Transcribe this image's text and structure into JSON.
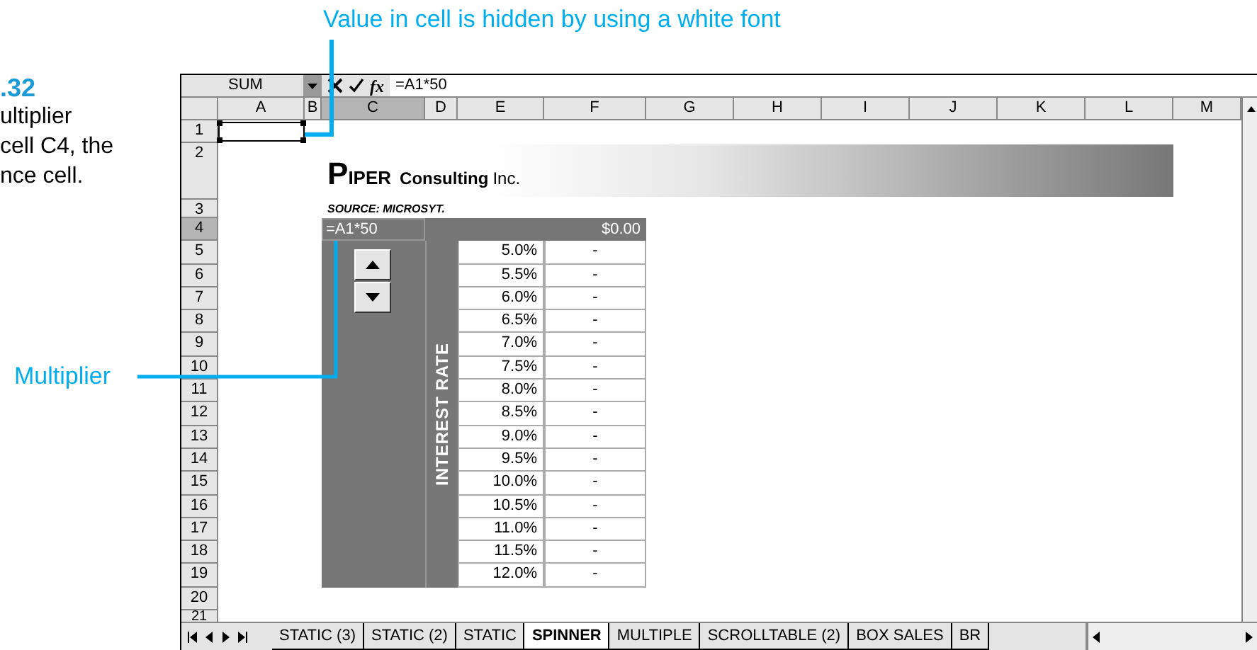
{
  "figure_label": ".32",
  "caption_lines": [
    "ultiplier",
    "cell C4, the",
    "nce cell."
  ],
  "callouts": [
    {
      "text": "Value in cell is hidden by using a white font"
    },
    {
      "text": "Multiplier"
    }
  ],
  "formula_bar": {
    "name_box": "SUM",
    "function_label": "fx",
    "formula": "=A1*50"
  },
  "columns": [
    {
      "label": "A",
      "selected": false
    },
    {
      "label": "B",
      "selected": false
    },
    {
      "label": "C",
      "selected": true
    },
    {
      "label": "D",
      "selected": false
    },
    {
      "label": "E",
      "selected": false
    },
    {
      "label": "F",
      "selected": false
    },
    {
      "label": "G",
      "selected": false
    },
    {
      "label": "H",
      "selected": false
    },
    {
      "label": "I",
      "selected": false
    },
    {
      "label": "J",
      "selected": false
    },
    {
      "label": "K",
      "selected": false
    },
    {
      "label": "L",
      "selected": false
    },
    {
      "label": "M",
      "selected": false
    }
  ],
  "rows": [
    {
      "label": "1",
      "selected": false
    },
    {
      "label": "2",
      "selected": false
    },
    {
      "label": "3",
      "selected": false
    },
    {
      "label": "4",
      "selected": true
    },
    {
      "label": "5",
      "selected": false
    },
    {
      "label": "6",
      "selected": false
    },
    {
      "label": "7",
      "selected": false
    },
    {
      "label": "8",
      "selected": false
    },
    {
      "label": "9",
      "selected": false
    },
    {
      "label": "10",
      "selected": false
    },
    {
      "label": "11",
      "selected": false
    },
    {
      "label": "12",
      "selected": false
    },
    {
      "label": "13",
      "selected": false
    },
    {
      "label": "14",
      "selected": false
    },
    {
      "label": "15",
      "selected": false
    },
    {
      "label": "16",
      "selected": false
    },
    {
      "label": "17",
      "selected": false
    },
    {
      "label": "18",
      "selected": false
    },
    {
      "label": "19",
      "selected": false
    },
    {
      "label": "20",
      "selected": false
    },
    {
      "label": "21",
      "selected": false
    }
  ],
  "linked_cell": {
    "selected": true
  },
  "logo": {
    "initial": "P",
    "name": "IPER",
    "subtitle": "Consulting",
    "suffix": "Inc."
  },
  "source": "SOURCE: MICROSYT.",
  "input_cell": "=A1*50",
  "result": "$0.00",
  "axis_label": "INTEREST RATE",
  "table": [
    {
      "rate": "5.0%",
      "value": "-"
    },
    {
      "rate": "5.5%",
      "value": "-"
    },
    {
      "rate": "6.0%",
      "value": "-"
    },
    {
      "rate": "6.5%",
      "value": "-"
    },
    {
      "rate": "7.0%",
      "value": "-"
    },
    {
      "rate": "7.5%",
      "value": "-"
    },
    {
      "rate": "8.0%",
      "value": "-"
    },
    {
      "rate": "8.5%",
      "value": "-"
    },
    {
      "rate": "9.0%",
      "value": "-"
    },
    {
      "rate": "9.5%",
      "value": "-"
    },
    {
      "rate": "10.0%",
      "value": "-"
    },
    {
      "rate": "10.5%",
      "value": "-"
    },
    {
      "rate": "11.0%",
      "value": "-"
    },
    {
      "rate": "11.5%",
      "value": "-"
    },
    {
      "rate": "12.0%",
      "value": "-"
    }
  ],
  "sheet_tabs": [
    {
      "label": "STATIC (3)",
      "selected": false
    },
    {
      "label": "STATIC (2)",
      "selected": false
    },
    {
      "label": "STATIC",
      "selected": false
    },
    {
      "label": "SPINNER",
      "selected": true
    },
    {
      "label": "MULTIPLE",
      "selected": false
    },
    {
      "label": "SCROLLTABLE (2)",
      "selected": false
    },
    {
      "label": "BOX SALES",
      "selected": false
    },
    {
      "label": "BR",
      "selected": false
    }
  ]
}
